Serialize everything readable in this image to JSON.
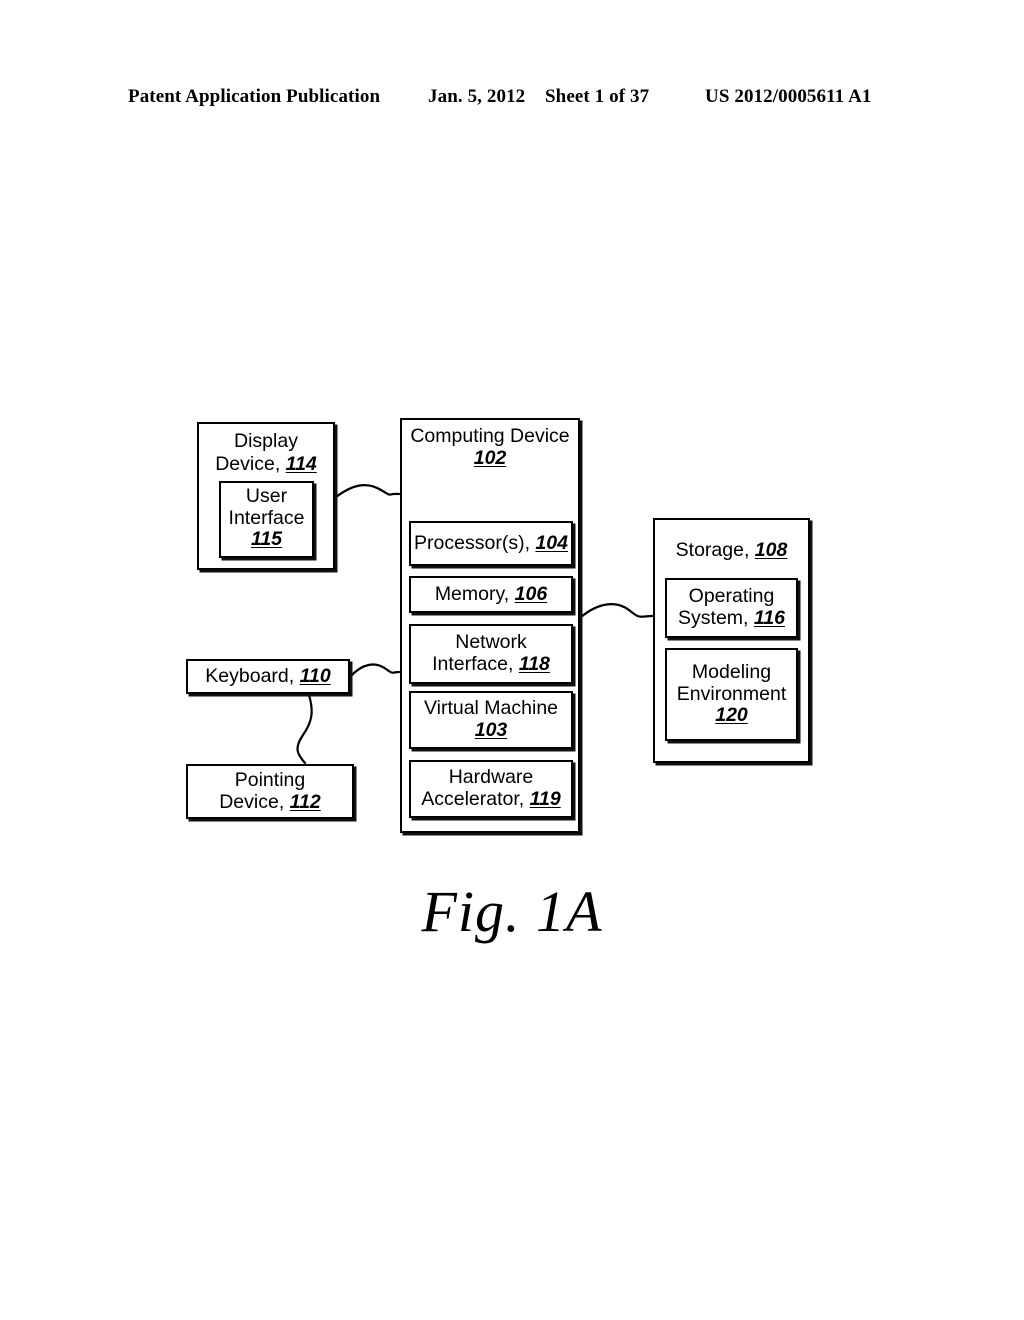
{
  "header": {
    "publication": "Patent Application Publication",
    "date": "Jan. 5, 2012",
    "sheet": "Sheet 1 of 37",
    "patent_number": "US 2012/0005611 A1"
  },
  "figure": {
    "caption": "Fig. 1A",
    "blocks": {
      "display_device": {
        "line1": "Display",
        "line2": "Device, ",
        "ref": "114"
      },
      "user_interface": {
        "line1": "User",
        "line2": "Interface",
        "ref": "115"
      },
      "computing_device": {
        "line1": "Computing Device",
        "ref": "102"
      },
      "processors": {
        "line1": "Processor(s), ",
        "ref": "104"
      },
      "memory": {
        "line1": "Memory, ",
        "ref": "106"
      },
      "network_interface": {
        "line1": "Network",
        "line2": "Interface, ",
        "ref": "118"
      },
      "virtual_machine": {
        "line1": "Virtual Machine",
        "ref": "103"
      },
      "hardware_accelerator": {
        "line1": "Hardware",
        "line2": "Accelerator, ",
        "ref": "119"
      },
      "storage": {
        "line1": "Storage, ",
        "ref": "108"
      },
      "operating_system": {
        "line1": "Operating",
        "line2": "System, ",
        "ref": "116"
      },
      "modeling_environment": {
        "line1": "Modeling",
        "line2": "Environment",
        "ref": "120"
      },
      "keyboard": {
        "line1": "Keyboard, ",
        "ref": "110"
      },
      "pointing_device": {
        "line1": "Pointing",
        "line2": "Device, ",
        "ref": "112"
      }
    },
    "connections": [
      {
        "from": "display_device",
        "to": "computing_device"
      },
      {
        "from": "computing_device",
        "to": "storage"
      },
      {
        "from": "keyboard",
        "to": "computing_device"
      },
      {
        "from": "keyboard",
        "to": "pointing_device"
      }
    ]
  },
  "colors": {
    "ink": "#000000",
    "paper": "#ffffff"
  }
}
